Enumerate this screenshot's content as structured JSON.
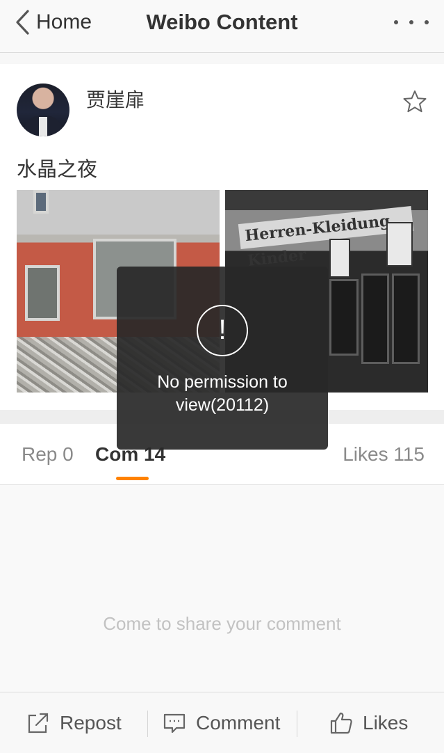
{
  "header": {
    "back_label": "Home",
    "title": "Weibo Content"
  },
  "post": {
    "username": "贾崖扉",
    "text": "水晶之夜",
    "images": [
      {
        "icon": "building-ruin-photo"
      },
      {
        "icon": "shopfront-photo",
        "sign_text": "Herren-Kleidung Kinder"
      }
    ]
  },
  "tabs": {
    "rep": "Rep 0",
    "com": "Com 14",
    "likes": "Likes 115",
    "active_color": "#ff8200"
  },
  "comments": {
    "empty_text": "Come to share your comment"
  },
  "bottom_bar": {
    "repost": "Repost",
    "comment": "Comment",
    "likes": "Likes"
  },
  "toast": {
    "icon": "!",
    "message": "No permission to view(20112)"
  }
}
